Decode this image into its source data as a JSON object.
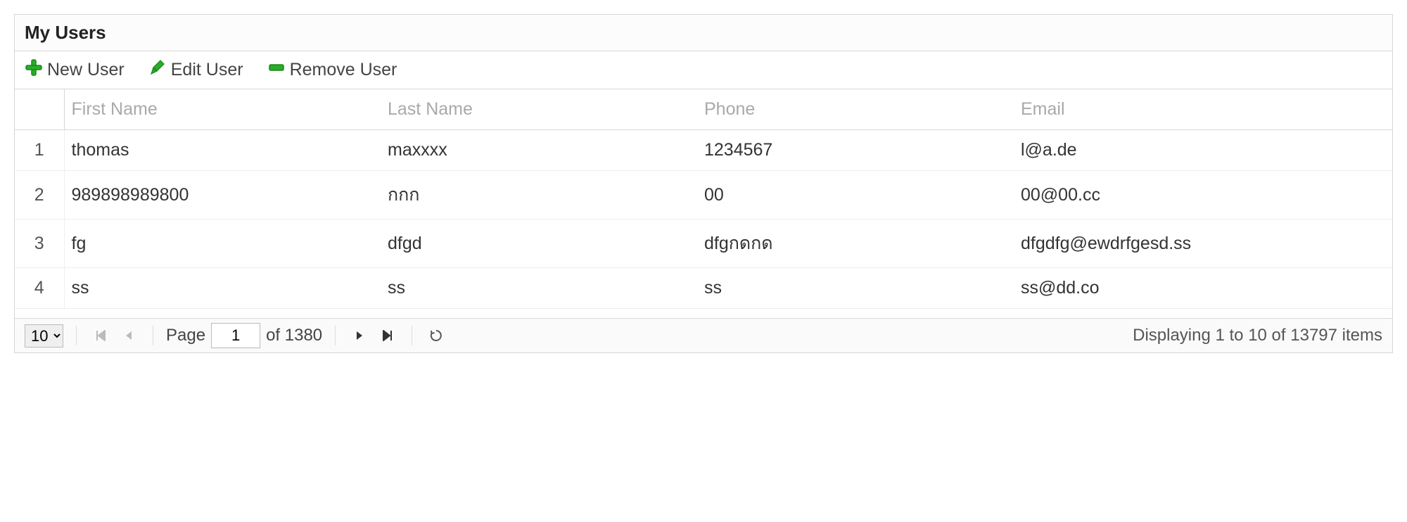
{
  "panel": {
    "title": "My Users"
  },
  "toolbar": {
    "new_label": "New User",
    "edit_label": "Edit User",
    "remove_label": "Remove User"
  },
  "columns": {
    "first_name": "First Name",
    "last_name": "Last Name",
    "phone": "Phone",
    "email": "Email"
  },
  "rows": [
    {
      "n": "1",
      "first_name": "thomas",
      "last_name": "maxxxx",
      "phone": "1234567",
      "email": "l@a.de"
    },
    {
      "n": "2",
      "first_name": "989898989800",
      "last_name": "กกก",
      "phone": "00",
      "email": "00@00.cc"
    },
    {
      "n": "3",
      "first_name": "fg",
      "last_name": "dfgd",
      "phone": "dfgกดกด",
      "email": "dfgdfg@ewdrfgesd.ss"
    },
    {
      "n": "4",
      "first_name": "ss",
      "last_name": "ss",
      "phone": "ss",
      "email": "ss@dd.co"
    }
  ],
  "pager": {
    "page_size_selected": "10",
    "page_label": "Page",
    "page_current": "1",
    "of_label": "of 1380",
    "display_msg": "Displaying 1 to 10 of 13797 items"
  }
}
